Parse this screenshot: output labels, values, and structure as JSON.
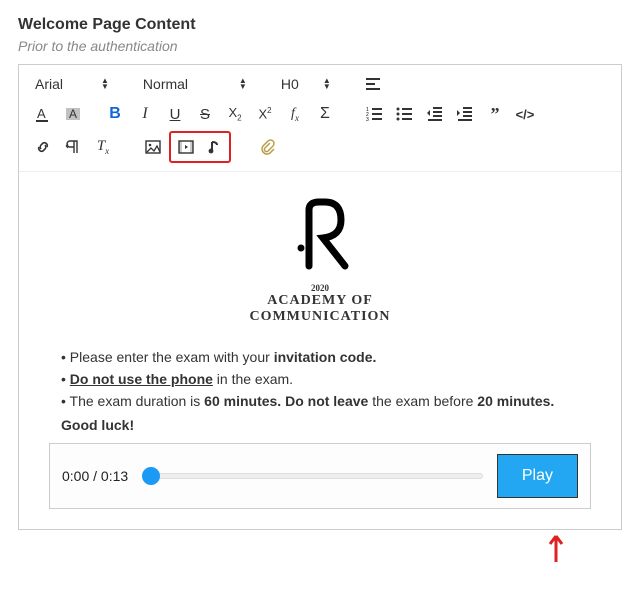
{
  "header": {
    "title": "Welcome Page Content",
    "subtitle": "Prior to the authentication"
  },
  "toolbar": {
    "font_select": "Arial",
    "size_select": "Normal",
    "heading_select": "H0"
  },
  "logo": {
    "year": "2020",
    "line1": "ACADEMY OF",
    "line2": "COMMUNICATION"
  },
  "bullets": {
    "b1a": "Please enter the exam with your ",
    "b1b": "invitation code.",
    "b2a": "Do not use the phone",
    "b2b": " in the exam.",
    "b3a": "The exam duration is ",
    "b3b": "60 minutes. Do not leave",
    "b3c": " the exam before ",
    "b3d": "20 minutes."
  },
  "goodluck": "Good luck!",
  "player": {
    "time": "0:00 / 0:13",
    "play_label": "Play"
  }
}
